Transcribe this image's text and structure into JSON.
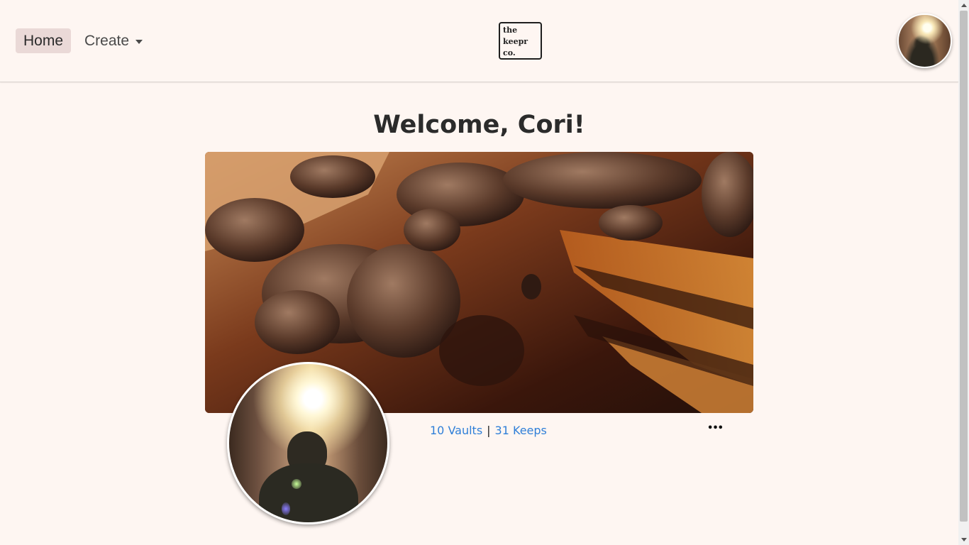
{
  "nav": {
    "home_label": "Home",
    "create_label": "Create",
    "logo_lines": [
      "the",
      "keepr",
      "co."
    ]
  },
  "profile": {
    "welcome": "Welcome, Cori!",
    "vaults": "10 Vaults",
    "separator": "|",
    "keeps": "31 Keeps",
    "more_label": "•••"
  },
  "icons": {
    "create_caret": "caret-down-icon",
    "more": "ellipsis-icon",
    "scroll_up": "arrow-up-icon",
    "scroll_down": "arrow-down-icon"
  },
  "colors": {
    "background": "#fef6f2",
    "home_active": "#ead9d7",
    "link": "#2f7fd8"
  }
}
